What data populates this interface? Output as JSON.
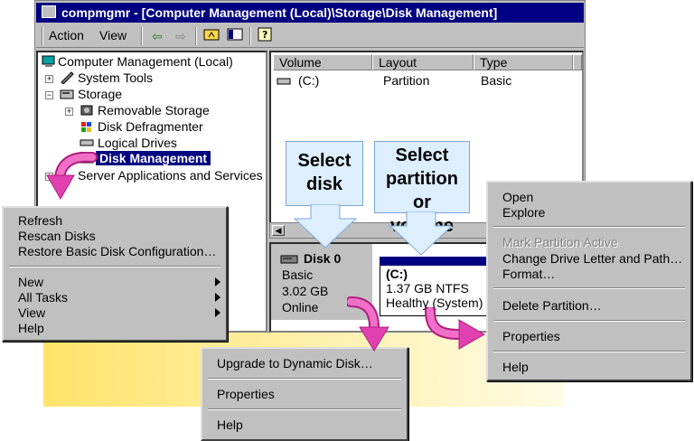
{
  "window": {
    "title": "compmgmr - [Computer Management (Local)\\Storage\\Disk Management]"
  },
  "toolbar": {
    "action_label": "Action",
    "view_label": "View"
  },
  "tree": {
    "root": "Computer Management (Local)",
    "system_tools": "System Tools",
    "storage": "Storage",
    "removable_storage": "Removable Storage",
    "disk_defragmenter": "Disk Defragmenter",
    "logical_drives": "Logical Drives",
    "disk_management": "Disk Management",
    "server_apps": "Server Applications and Services"
  },
  "volume_list": {
    "headers": [
      "Volume",
      "Layout",
      "Type"
    ],
    "rows": [
      {
        "volume": "(C:)",
        "layout": "Partition",
        "type": "Basic"
      }
    ]
  },
  "disk": {
    "name": "Disk 0",
    "type": "Basic",
    "size": "3.02 GB",
    "status": "Online"
  },
  "partition": {
    "label": "(C:)",
    "size_fs": "1.37 GB NTFS",
    "health": "Healthy (System)"
  },
  "callouts": {
    "select_disk": [
      "Select",
      "disk"
    ],
    "select_partition": [
      "Select",
      "partition or",
      "volume"
    ]
  },
  "menu_disk_management": {
    "items": [
      "Refresh",
      "Rescan Disks",
      "Restore Basic Disk Configuration…"
    ],
    "submenus": [
      "New",
      "All Tasks",
      "View"
    ],
    "help": "Help"
  },
  "menu_disk": {
    "upgrade": "Upgrade to Dynamic Disk…",
    "properties": "Properties",
    "help": "Help"
  },
  "menu_partition": {
    "open": "Open",
    "explore": "Explore",
    "mark_active": "Mark Partition Active",
    "change_letter": "Change Drive Letter and Path…",
    "format": "Format…",
    "delete": "Delete Partition…",
    "properties": "Properties",
    "help": "Help"
  },
  "colors": {
    "title_bar": "#000080",
    "window_face": "#c0c0c0",
    "arrow_pink": "#e040b0",
    "callout_blue": "#ddeeff"
  }
}
